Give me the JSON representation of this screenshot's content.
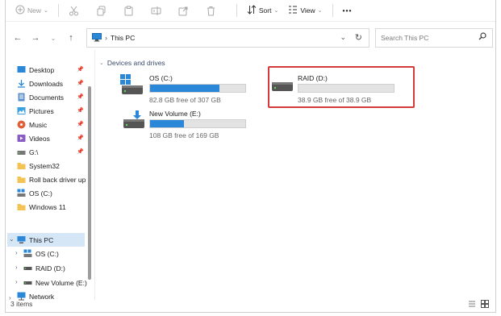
{
  "toolbar": {
    "new_label": "New",
    "sort_label": "Sort",
    "view_label": "View",
    "more_label": "•••"
  },
  "address": {
    "crumb": "This PC",
    "search_placeholder": "Search This PC"
  },
  "sidebar": {
    "quick": [
      {
        "label": "Desktop",
        "icon": "desktop-icon",
        "pinned": true
      },
      {
        "label": "Downloads",
        "icon": "download-icon",
        "pinned": true
      },
      {
        "label": "Documents",
        "icon": "documents-icon",
        "pinned": true
      },
      {
        "label": "Pictures",
        "icon": "pictures-icon",
        "pinned": true
      },
      {
        "label": "Music",
        "icon": "music-icon",
        "pinned": true
      },
      {
        "label": "Videos",
        "icon": "videos-icon",
        "pinned": true
      },
      {
        "label": "G:\\",
        "icon": "drive-icon",
        "pinned": true
      },
      {
        "label": "System32",
        "icon": "folder-icon",
        "pinned": false
      },
      {
        "label": "Roll back driver up",
        "icon": "folder-icon",
        "pinned": false
      },
      {
        "label": "OS (C:)",
        "icon": "windows-drive-icon",
        "pinned": false
      },
      {
        "label": "Windows 11",
        "icon": "folder-icon",
        "pinned": false
      }
    ],
    "this_pc": "This PC",
    "children": [
      {
        "label": "OS (C:)",
        "icon": "windows-drive-icon"
      },
      {
        "label": "RAID (D:)",
        "icon": "drive-icon"
      },
      {
        "label": "New Volume (E:)",
        "icon": "drive-icon"
      }
    ],
    "network": "Network"
  },
  "content": {
    "group_header": "Devices and drives",
    "drives": [
      {
        "name": "OS (C:)",
        "free_text": "82.8 GB free of 307 GB",
        "used_fraction": 0.73
      },
      {
        "name": "New Volume (E:)",
        "free_text": "108 GB free of 169 GB",
        "used_fraction": 0.36
      },
      {
        "name": "RAID (D:)",
        "free_text": "38.9 GB free of 38.9 GB",
        "used_fraction": 0.0
      }
    ]
  },
  "status": {
    "items": "3 items"
  },
  "colors": {
    "accent": "#2b88d8",
    "highlight": "#d33a3a",
    "selection": "#d5e6f7"
  }
}
